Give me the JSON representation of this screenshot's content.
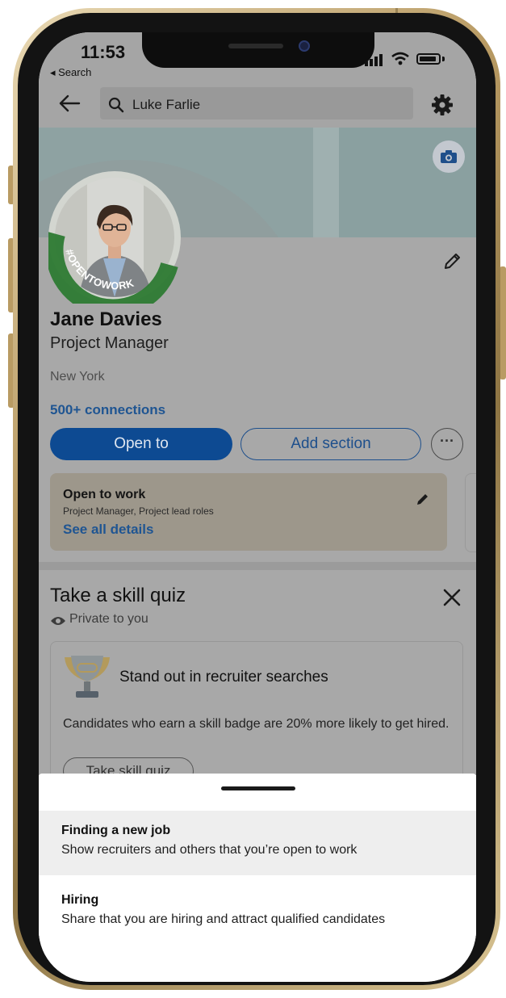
{
  "status_bar": {
    "time": "11:53",
    "back_label": "◂ Search"
  },
  "search": {
    "query": "Luke Farlie"
  },
  "profile": {
    "name": "Jane Davies",
    "headline": "Project Manager",
    "location": "New York",
    "connections": "500+ connections",
    "badge_text": "#OPENTOWORK"
  },
  "actions": {
    "open_to": "Open to",
    "add_section": "Add section",
    "more": "···"
  },
  "open_to_work_card": {
    "title": "Open to work",
    "roles": "Project Manager, Project lead roles",
    "link": "See all details"
  },
  "skill_quiz": {
    "title": "Take a skill quiz",
    "visibility": "Private to you",
    "headline": "Stand out in recruiter searches",
    "description": "Candidates who earn a skill badge are 20% more likely to get hired.",
    "button": "Take skill quiz"
  },
  "bottom_sheet": {
    "options": [
      {
        "title": "Finding a new job",
        "description": "Show recruiters and others that you’re open to work"
      },
      {
        "title": "Hiring",
        "description": "Share that you are hiring and attract qualified candidates"
      }
    ]
  },
  "colors": {
    "brand_blue": "#0d4a92",
    "link_blue": "#1f5592",
    "badge_green": "#2f7b34"
  },
  "icons": [
    "back-arrow-icon",
    "search-icon",
    "gear-icon",
    "camera-icon",
    "pencil-icon",
    "close-icon",
    "eye-icon",
    "trophy-icon",
    "signal-icon",
    "wifi-icon",
    "battery-icon"
  ]
}
